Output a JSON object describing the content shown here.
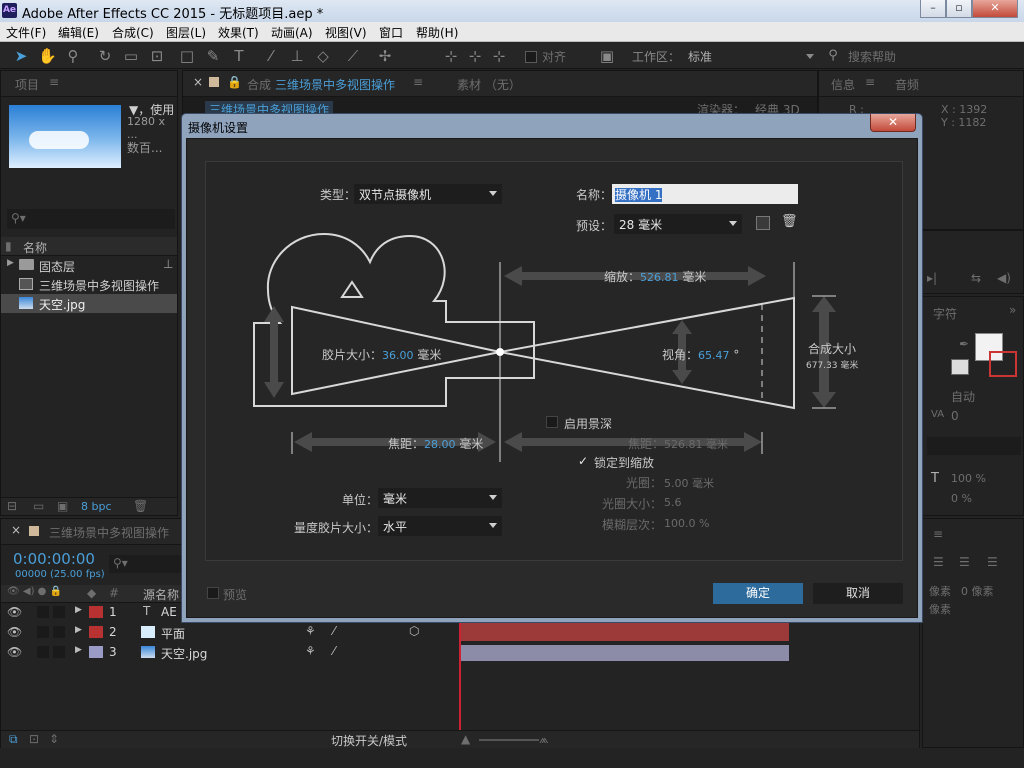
{
  "window": {
    "title": "Adobe After Effects CC 2015 - 无标题项目.aep *",
    "logo": "Ae",
    "min": "–",
    "max": "▫",
    "close": "✕"
  },
  "menu": [
    "文件(F)",
    "编辑(E)",
    "合成(C)",
    "图层(L)",
    "效果(T)",
    "动画(A)",
    "视图(V)",
    "窗口",
    "帮助(H)"
  ],
  "toolbar": {
    "snap_label": "对齐",
    "workspace_label": "工作区：",
    "workspace_value": "标准",
    "search_placeholder": "搜索帮助"
  },
  "project": {
    "tab": "项目",
    "thumb_info1": "▼，使用",
    "thumb_info2": "1280 x ...",
    "thumb_info3": "数百...",
    "col_name": "名称",
    "items": [
      {
        "name": "固态层",
        "kind": "folder"
      },
      {
        "name": "三维场景中多视图操作",
        "kind": "comp"
      },
      {
        "name": "天空.jpg",
        "kind": "image"
      }
    ],
    "bpc": "8 bpc"
  },
  "comp_panel": {
    "tab_prefix": "合成",
    "tab": "三维场景中多视图操作",
    "tab2": "素材 （无）",
    "subtab": "三维场景中多视图操作",
    "renderer_label": "渲染器：",
    "renderer_value": "经典 3D"
  },
  "info_panel": {
    "tab": "信息",
    "tab2": "音频",
    "r_label": "R :",
    "x": "X : 1392",
    "y": "Y : 1182"
  },
  "char_panel": {
    "tab": "字符",
    "auto": "自动",
    "va": "0",
    "scale": "100 %",
    "baseline": "0 %",
    "px1": "像素",
    "px2": "0 像素",
    "px3": "像素"
  },
  "timeline": {
    "tab": "三维场景中多视图操作",
    "timecode": "0:00:00:00",
    "fps": "00000 (25.00 fps)",
    "col_source": "源名称",
    "col_num": "#",
    "layers": [
      {
        "num": "1",
        "name": "AE",
        "color": "#b83232",
        "icon": "T"
      },
      {
        "num": "2",
        "name": "平面",
        "color": "#b83232",
        "icon": "solid"
      },
      {
        "num": "3",
        "name": "天空.jpg",
        "color": "#9b9bc8",
        "icon": "image"
      }
    ],
    "toggle_label": "切换开关/模式"
  },
  "dialog": {
    "title": "摄像机设置",
    "close": "✕",
    "type_label": "类型：",
    "type_value": "双节点摄像机",
    "name_label": "名称：",
    "name_value": "摄像机 1",
    "preset_label": "预设：",
    "preset_value": "28 毫米",
    "zoom_label": "缩放：",
    "zoom_value": "526.81",
    "zoom_unit": "毫米",
    "film_label": "胶片大小：",
    "film_value": "36.00",
    "film_unit": "毫米",
    "aov_label": "视角：",
    "aov_value": "65.47",
    "aov_unit": "°",
    "comp_size_label": "合成大小",
    "comp_size_value": "677.33 毫米",
    "dof_label": "启用景深",
    "focal_label": "焦距：",
    "focal_value": "28.00",
    "focal_unit": "毫米",
    "focus_label": "焦距：",
    "focus_value": "526.81 毫米",
    "lock_label": "锁定到缩放",
    "aperture_label": "光圈：",
    "aperture_value": "5.00 毫米",
    "fstop_label": "光圈大小：",
    "fstop_value": "5.6",
    "blur_label": "模糊层次：",
    "blur_value": "100.0 %",
    "units_label": "单位：",
    "units_value": "毫米",
    "measure_label": "量度胶片大小：",
    "measure_value": "水平",
    "preview_label": "预览",
    "ok": "确定",
    "cancel": "取消"
  },
  "colors": {
    "accent": "#4a9fd8",
    "ok_button": "#2d6b9c",
    "dialog_frame": "#8fa3bd"
  }
}
